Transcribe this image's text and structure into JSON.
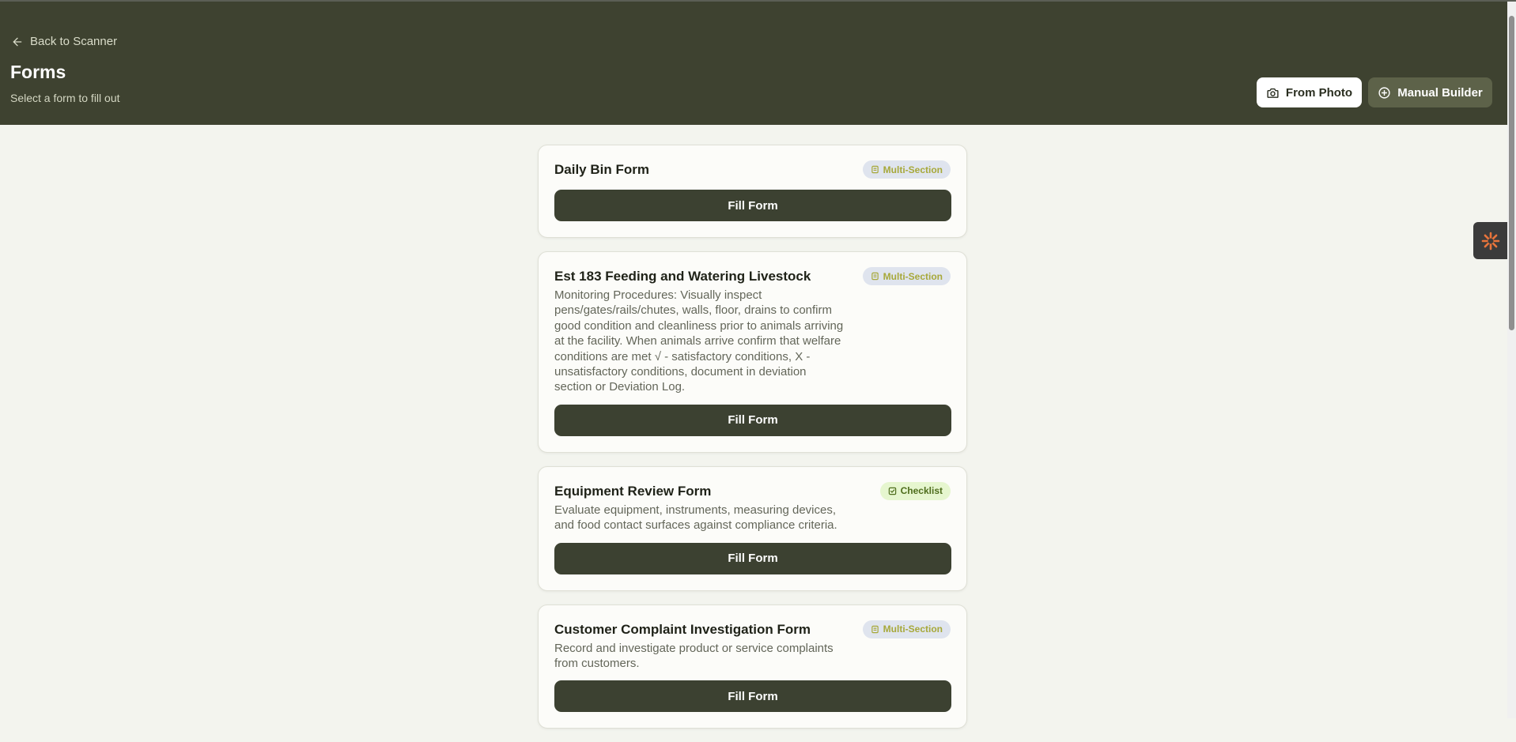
{
  "header": {
    "back_label": "Back to Scanner",
    "title": "Forms",
    "subtitle": "Select a form to fill out",
    "from_photo_label": "From Photo",
    "manual_builder_label": "Manual Builder"
  },
  "forms": [
    {
      "title": "Daily Bin Form",
      "badge": "Multi-Section",
      "badge_icon": "folder-icon",
      "description": "",
      "button_label": "Fill Form"
    },
    {
      "title": "Est 183 Feeding and Watering Livestock",
      "badge": "Multi-Section",
      "badge_icon": "folder-icon",
      "description": "Monitoring Procedures: Visually inspect pens/gates/rails/chutes, walls, floor, drains to confirm good condition and cleanliness prior to animals arriving at the facility. When animals arrive confirm that welfare conditions are met √ - satisfactory conditions, X - unsatisfactory conditions, document in deviation section or Deviation Log.",
      "button_label": "Fill Form"
    },
    {
      "title": "Equipment Review Form",
      "badge": "Checklist",
      "badge_icon": "check-square-icon",
      "description": "Evaluate equipment, instruments, measuring devices, and food contact surfaces against compliance criteria.",
      "button_label": "Fill Form"
    },
    {
      "title": "Customer Complaint Investigation Form",
      "badge": "Multi-Section",
      "badge_icon": "folder-icon",
      "description": "Record and investigate product or service complaints from customers.",
      "button_label": "Fill Form"
    }
  ],
  "colors": {
    "header_bg": "#3e4230",
    "page_bg": "#f3f4ee",
    "button_bg": "#3c4131",
    "accent_orange": "#e8743b",
    "badge_multi_bg": "#dfe4ee",
    "badge_checklist_bg": "#e6f6cf"
  }
}
